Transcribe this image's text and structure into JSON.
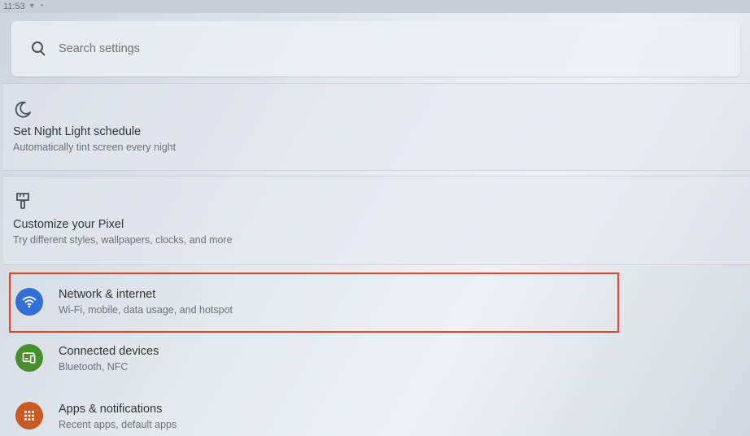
{
  "status_bar": {
    "time": "11:53"
  },
  "search": {
    "placeholder": "Search settings"
  },
  "suggestions": [
    {
      "title": "Set Night Light schedule",
      "subtitle": "Automatically tint screen every night",
      "icon": "moon-icon"
    },
    {
      "title": "Customize your Pixel",
      "subtitle": "Try different styles, wallpapers, clocks, and more",
      "icon": "paintbrush-icon"
    }
  ],
  "settings": [
    {
      "title": "Network & internet",
      "subtitle": "Wi-Fi, mobile, data usage, and hotspot",
      "icon": "wifi-icon",
      "color": "#2f6fd6"
    },
    {
      "title": "Connected devices",
      "subtitle": "Bluetooth, NFC",
      "icon": "devices-icon",
      "color": "#4a8f2e"
    },
    {
      "title": "Apps & notifications",
      "subtitle": "Recent apps, default apps",
      "icon": "apps-grid-icon",
      "color": "#c85a24"
    }
  ],
  "colors": {
    "highlight": "#e8432f"
  }
}
